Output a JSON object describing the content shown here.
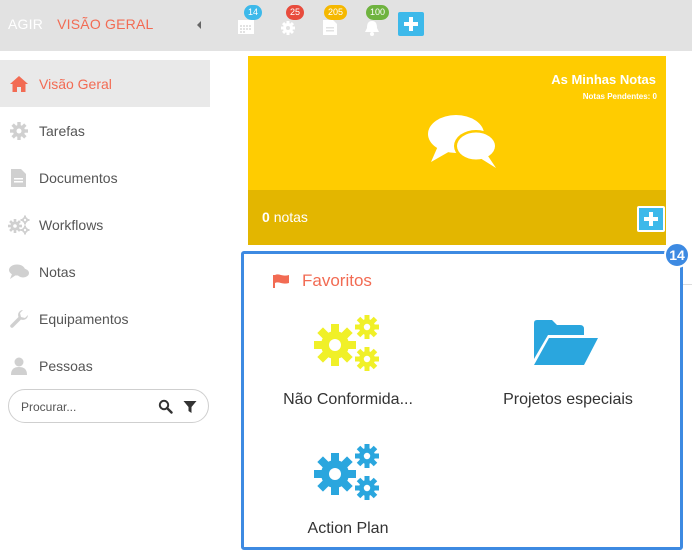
{
  "header": {
    "app_name": "AGIR",
    "section_title": "VISÃO GERAL",
    "badges": [
      {
        "icon": "calendar-icon",
        "count": "14",
        "color": "#3db9ea"
      },
      {
        "icon": "gear-icon",
        "count": "25",
        "color": "#e84c3d"
      },
      {
        "icon": "document-icon",
        "count": "205",
        "color": "#f5b800"
      },
      {
        "icon": "bell-icon",
        "count": "100",
        "color": "#6fb33f"
      }
    ],
    "add_icon": "plus-icon"
  },
  "sidebar": {
    "items": [
      {
        "label": "Visão Geral",
        "icon": "home-icon",
        "active": true
      },
      {
        "label": "Tarefas",
        "icon": "gear-icon"
      },
      {
        "label": "Documentos",
        "icon": "document-icon"
      },
      {
        "label": "Workflows",
        "icon": "gears-icon"
      },
      {
        "label": "Notas",
        "icon": "chat-icon"
      },
      {
        "label": "Equipamentos",
        "icon": "wrench-icon"
      },
      {
        "label": "Pessoas",
        "icon": "person-icon"
      }
    ],
    "search_placeholder": "Procurar..."
  },
  "notes_widget": {
    "title": "As Minhas Notas",
    "subtitle": "Notas Pendentes: 0",
    "count": "0",
    "count_label": "notas"
  },
  "favorites": {
    "step_number": "14",
    "title": "Favoritos",
    "items": [
      {
        "label": "Não Conformida...",
        "icon": "gears-icon",
        "color": "#f0f028"
      },
      {
        "label": "Projetos especiais",
        "icon": "folder-open-icon",
        "color": "#2aa6de"
      },
      {
        "label": "Action Plan",
        "icon": "gears-icon",
        "color": "#2aa6de"
      }
    ]
  },
  "colors": {
    "accent": "#f26b53",
    "notes_yellow": "#ffcc00",
    "add_blue": "#3db9ea",
    "highlight_blue": "#3d8ae2"
  }
}
